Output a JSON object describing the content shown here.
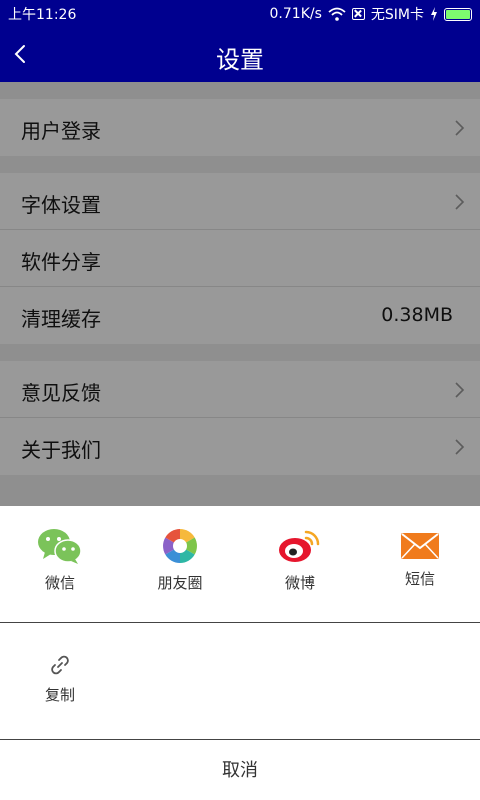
{
  "status_bar": {
    "time": "上午11:26",
    "net_speed": "0.71K/s",
    "sim": "无SIM卡"
  },
  "nav": {
    "title": "设置"
  },
  "settings": {
    "group1": [
      {
        "label": "用户登录"
      }
    ],
    "group2": [
      {
        "label": "字体设置"
      },
      {
        "label": "软件分享"
      },
      {
        "label": "清理缓存",
        "value": "0.38MB"
      }
    ],
    "group3": [
      {
        "label": "意见反馈"
      },
      {
        "label": "关于我们"
      }
    ]
  },
  "share_sheet": {
    "targets": [
      {
        "label": "微信",
        "icon": "wechat-icon"
      },
      {
        "label": "朋友圈",
        "icon": "moments-icon"
      },
      {
        "label": "微博",
        "icon": "weibo-icon"
      },
      {
        "label": "短信",
        "icon": "sms-icon"
      }
    ],
    "copy": {
      "label": "复制",
      "icon": "link-icon"
    },
    "cancel_label": "取消"
  },
  "colors": {
    "header": "#00008f",
    "battery": "#7dfb6f",
    "wechat": "#7bc35a",
    "sms": "#f07b1c",
    "weibo_red": "#e6162d"
  }
}
